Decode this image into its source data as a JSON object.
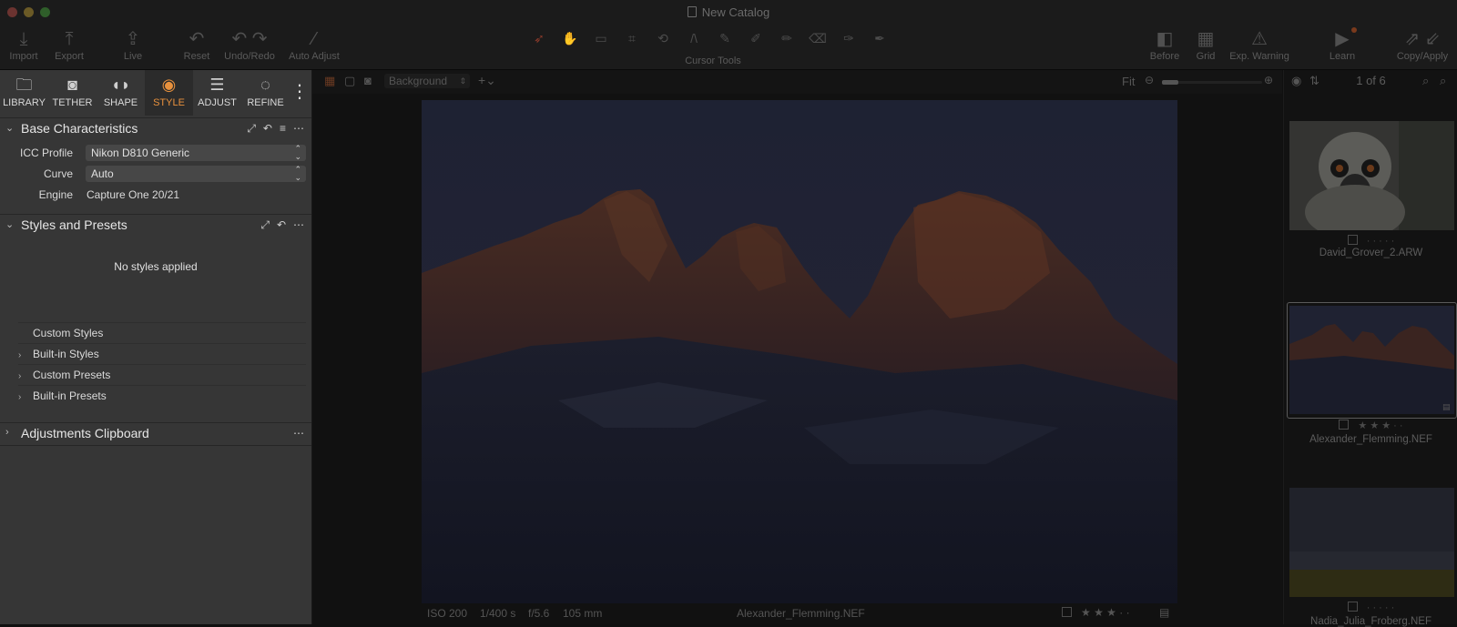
{
  "window": {
    "title": "New Catalog"
  },
  "toolbar": {
    "import": "Import",
    "export": "Export",
    "live": "Live",
    "reset": "Reset",
    "undo_redo": "Undo/Redo",
    "auto_adjust": "Auto Adjust",
    "cursor_tools": "Cursor Tools",
    "before": "Before",
    "grid": "Grid",
    "exp_warning": "Exp. Warning",
    "learn": "Learn",
    "copy_apply": "Copy/Apply"
  },
  "tool_tabs": [
    {
      "label": "LIBRARY",
      "icon": "folder-icon"
    },
    {
      "label": "TETHER",
      "icon": "camera-icon"
    },
    {
      "label": "SHAPE",
      "icon": "lens-icon"
    },
    {
      "label": "STYLE",
      "icon": "style-icon"
    },
    {
      "label": "ADJUST",
      "icon": "sliders-icon"
    },
    {
      "label": "REFINE",
      "icon": "refine-icon"
    }
  ],
  "base": {
    "title": "Base Characteristics",
    "icc_label": "ICC Profile",
    "icc_value": "Nikon D810 Generic",
    "curve_label": "Curve",
    "curve_value": "Auto",
    "engine_label": "Engine",
    "engine_value": "Capture One 20/21"
  },
  "styles": {
    "title": "Styles and Presets",
    "empty": "No styles applied",
    "items": [
      "Custom Styles",
      "Built-in Styles",
      "Custom Presets",
      "Built-in Presets"
    ]
  },
  "clipboard": {
    "title": "Adjustments Clipboard"
  },
  "viewer": {
    "layer": "Background",
    "fit": "Fit",
    "status": {
      "iso": "ISO 200",
      "shutter": "1/400 s",
      "aperture": "f/5.6",
      "focal": "105 mm",
      "filename": "Alexander_Flemming.NEF"
    },
    "rating": 3
  },
  "browser": {
    "count": "1 of 6",
    "thumbs": [
      {
        "name": "David_Grover_2.ARW",
        "rating": 0
      },
      {
        "name": "Alexander_Flemming.NEF",
        "rating": 3
      },
      {
        "name": "Nadia_Julia_Froberg.NEF",
        "rating": 0
      }
    ]
  }
}
